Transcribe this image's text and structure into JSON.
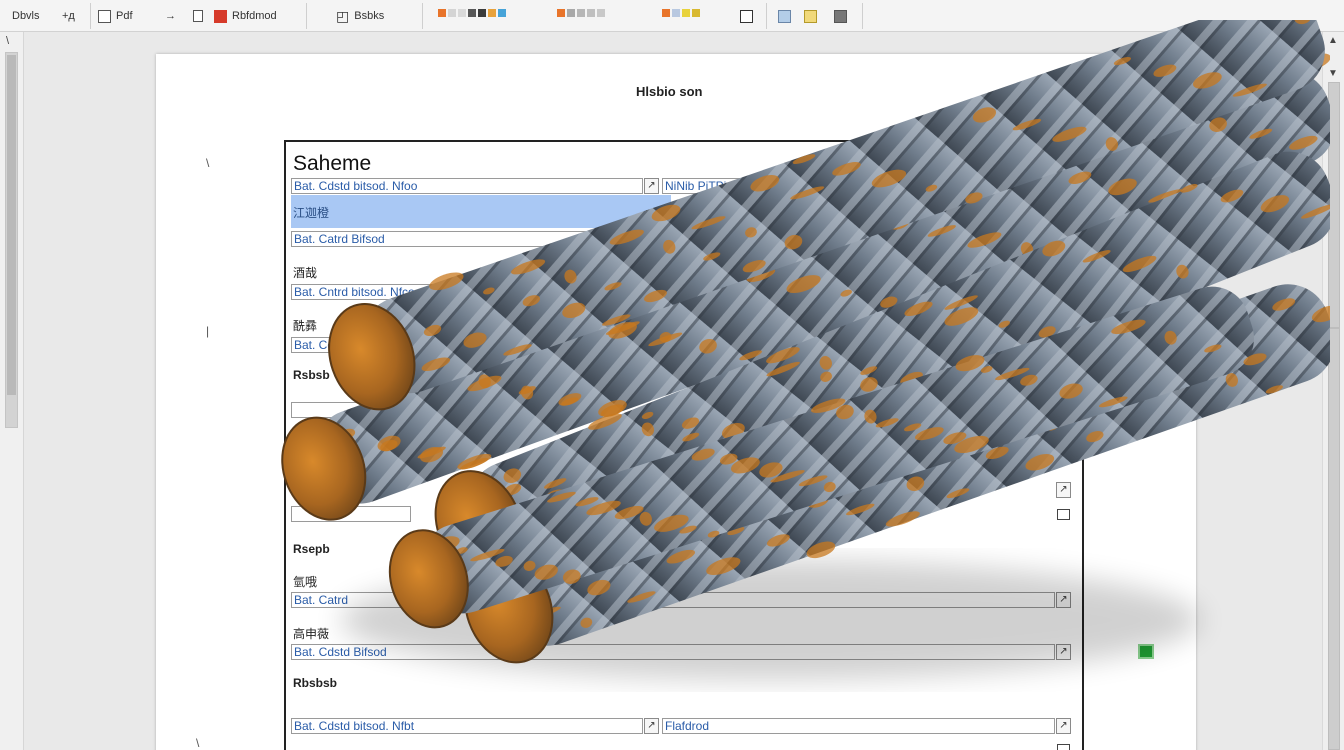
{
  "toolbar": {
    "undo_label": "Dbvls",
    "cursor_label": "+д",
    "paste_label": "Pdf",
    "arrow": "→",
    "format_label": "Rbfdmod",
    "shape_label": "Bsbks",
    "swatch_set_1": [
      "#e8742a",
      "#d4d4d4",
      "#d9d9d9",
      "#575757",
      "#3b3b3b",
      "#e8a23c",
      "#46a3d8"
    ],
    "swatch_set_2": [
      "#e8742a",
      "#a8a8a8",
      "#b6b6b6",
      "#bfbfbf",
      "#c8c8c8"
    ],
    "swatch_set_3": [
      "#e8742a",
      "#b8c8e0",
      "#e8d23c",
      "#d8b830"
    ],
    "extra_icons": [
      "paint-icon",
      "table-icon",
      "grid-icon",
      "dark-square-icon"
    ]
  },
  "ruler": {
    "mark": "\\"
  },
  "scrollbar": {
    "up": "▲",
    "down": "▼"
  },
  "page": {
    "title": "Hlsbio son",
    "left_marks": [
      "\\",
      "|",
      "\\"
    ]
  },
  "form": {
    "title": "Saheme",
    "row1": {
      "value": "Bat. Cdstd bitsod. Nfoo",
      "right_value": "NiNib PiTPidb",
      "dropdown_glyph": "↗"
    },
    "selected_row": {
      "label": "江迦橙"
    },
    "row2": {
      "value": "Bat. Catrd Bifsod"
    },
    "label_a": "酒哉",
    "row3": {
      "value": "Bat. Cntrd bitsod. Nfco"
    },
    "label_b": "酰彞",
    "row4": {
      "value": "Bat. Cdstd"
    },
    "section_1": "Rsbsb",
    "section_2": "Rsepb",
    "label_c": "氫哦",
    "row5": {
      "value": "Bat. Catrd"
    },
    "label_d": "高申薇",
    "row6": {
      "value": "Bat. Cdstd Bifsod"
    },
    "section_3": "Rbsbsb",
    "row7": {
      "value": "Bat. Cdstd bitsod. Nfbt",
      "right_value": "Flafdrod",
      "dropdown_glyph": "↗"
    }
  },
  "colors": {
    "accent_selection": "#a9c8f4",
    "link_text": "#2a5ca8",
    "status_green": "#1f9a32"
  }
}
